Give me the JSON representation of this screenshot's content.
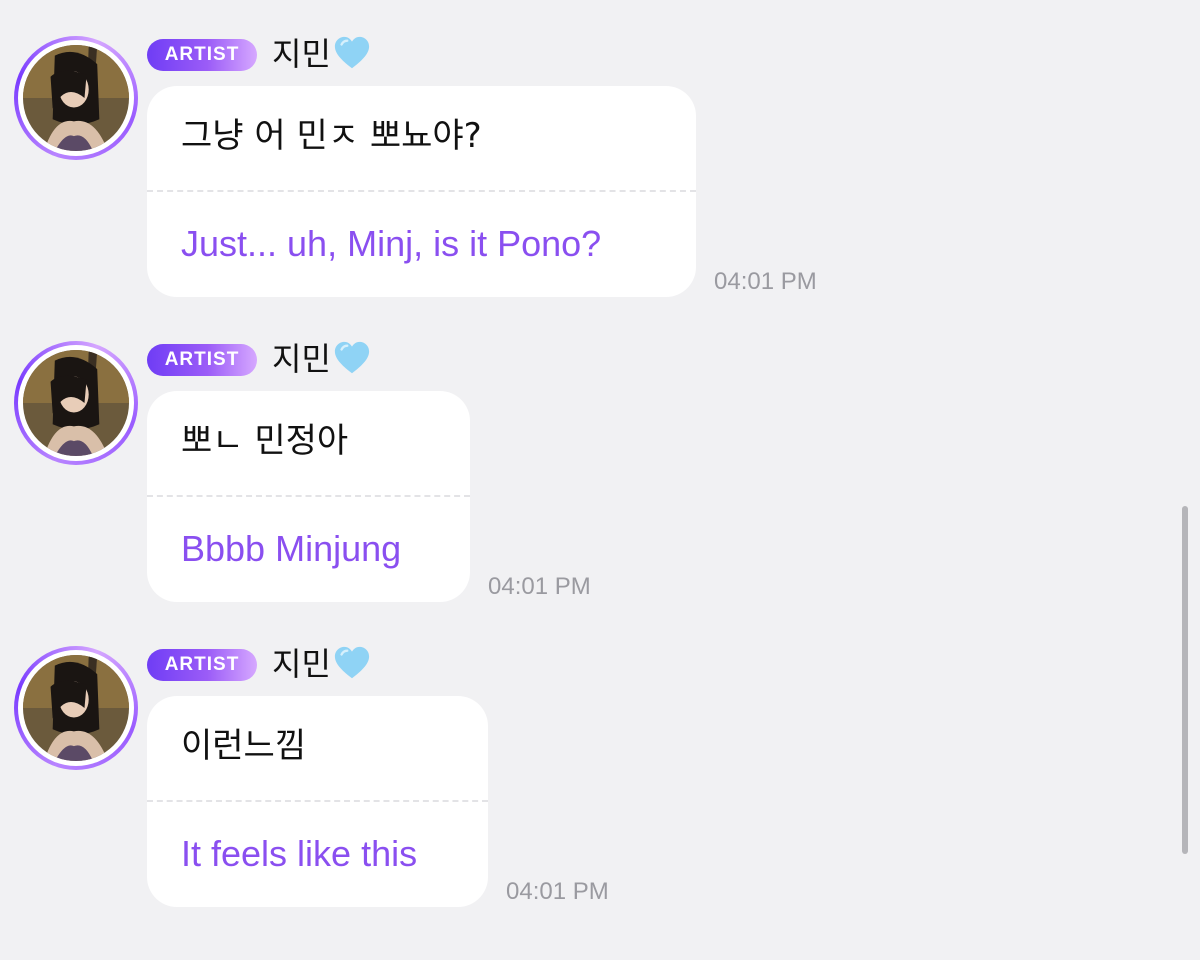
{
  "messages": [
    {
      "badge": "ARTIST",
      "sender": "지민",
      "heart_icon": "light-blue-heart-icon",
      "original_text": "그냥 어 민ㅈ 뽀뇨야?",
      "translation": "Just... uh, Minj, is it Pono?",
      "time": "04:01 PM"
    },
    {
      "badge": "ARTIST",
      "sender": "지민",
      "heart_icon": "light-blue-heart-icon",
      "original_text": "뽀ㄴ 민정아",
      "translation": "Bbbb Minjung",
      "time": "04:01 PM"
    },
    {
      "badge": "ARTIST",
      "sender": "지민",
      "heart_icon": "light-blue-heart-icon",
      "original_text": "이런느낌",
      "translation": "It feels like this",
      "time": "04:01 PM"
    }
  ],
  "colors": {
    "background": "#f1f1f3",
    "translation_text": "#8a4ff0",
    "badge_start": "#6f3df5",
    "badge_end": "#d6a8ff",
    "heart": "#8fd3f5",
    "timestamp": "#9a9aa0"
  }
}
